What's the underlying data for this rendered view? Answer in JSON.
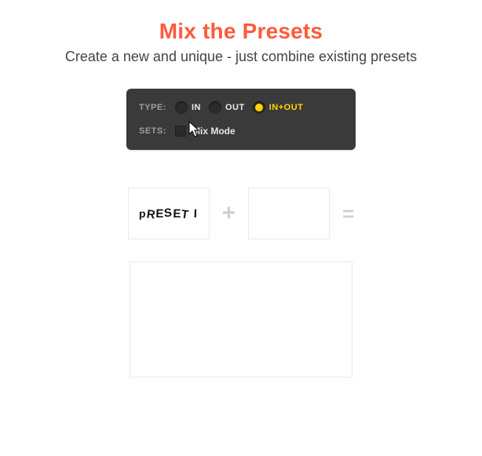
{
  "header": {
    "title": "Mix the Presets",
    "subtitle": "Create a new and unique - just combine existing presets"
  },
  "panel": {
    "type_label": "TYPE:",
    "sets_label": "SETS:",
    "type_options": {
      "in": "IN",
      "out": "OUT",
      "inout": "IN+OUT"
    },
    "mix_mode_label": "Mix Mode"
  },
  "equation": {
    "preset1_text": "PRESET I",
    "plus": "+",
    "equals": "=",
    "preset2_text": ""
  }
}
